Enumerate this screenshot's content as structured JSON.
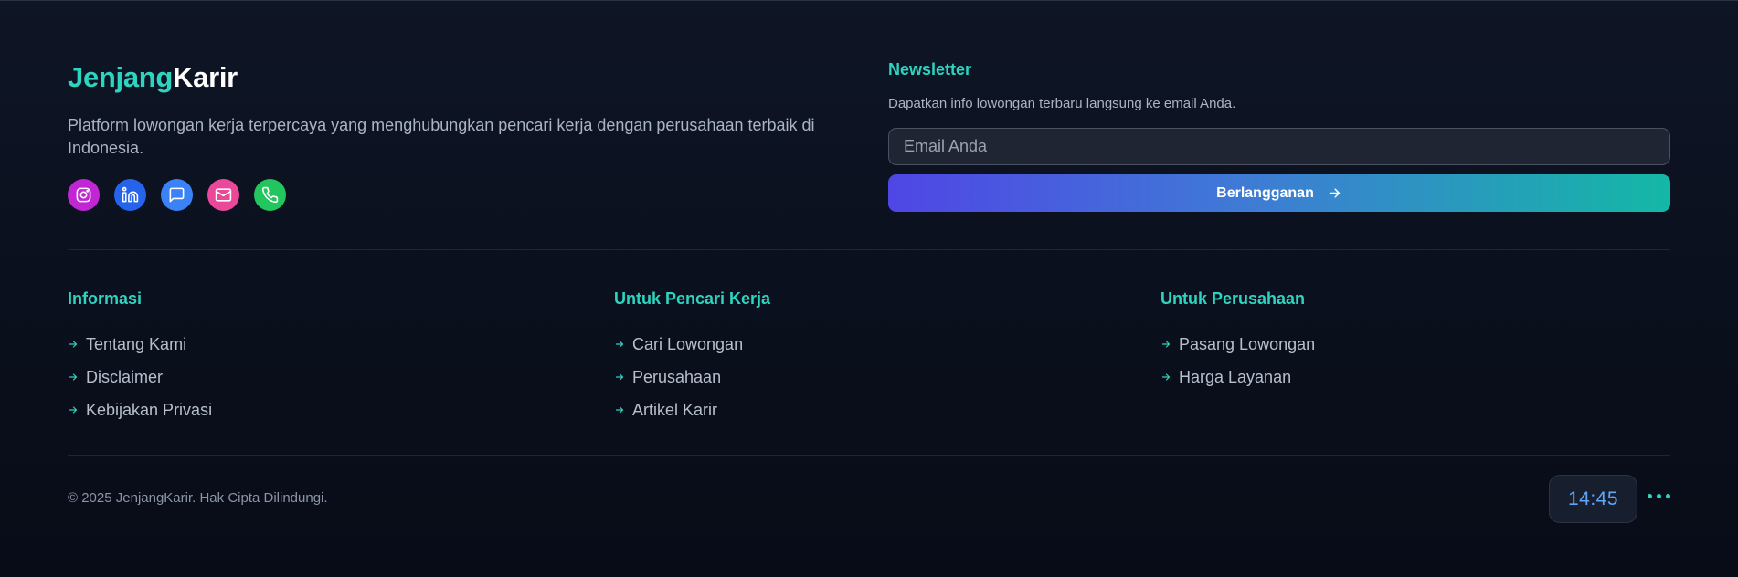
{
  "brand": {
    "part1": "Jenjang",
    "part2": "Karir"
  },
  "description": "Platform lowongan kerja terpercaya yang menghubungkan pencari kerja dengan perusahaan terbaik di Indonesia.",
  "socials": [
    {
      "icon": "instagram-icon",
      "color": "#c026d3"
    },
    {
      "icon": "linkedin-icon",
      "color": "#2563eb"
    },
    {
      "icon": "chat-icon",
      "color": "#3b82f6"
    },
    {
      "icon": "mail-icon",
      "color": "#ec4899"
    },
    {
      "icon": "phone-icon",
      "color": "#22c55e"
    }
  ],
  "newsletter": {
    "title": "Newsletter",
    "subtitle": "Dapatkan info lowongan terbaru langsung ke email Anda.",
    "email_placeholder": "Email Anda",
    "email_value": "",
    "button_label": "Berlangganan"
  },
  "columns": [
    {
      "title": "Informasi",
      "items": [
        "Tentang Kami",
        "Disclaimer",
        "Kebijakan Privasi"
      ]
    },
    {
      "title": "Untuk Pencari Kerja",
      "items": [
        "Cari Lowongan",
        "Perusahaan",
        "Artikel Karir"
      ]
    },
    {
      "title": "Untuk Perusahaan",
      "items": [
        "Pasang Lowongan",
        "Harga Layanan"
      ]
    }
  ],
  "copyright": "© 2025 JenjangKarir. Hak Cipta Dilindungi.",
  "clock": "14:45",
  "colors": {
    "accent": "#2dd4bf",
    "background": "#0b1120",
    "clock_text": "#60a5fa"
  }
}
